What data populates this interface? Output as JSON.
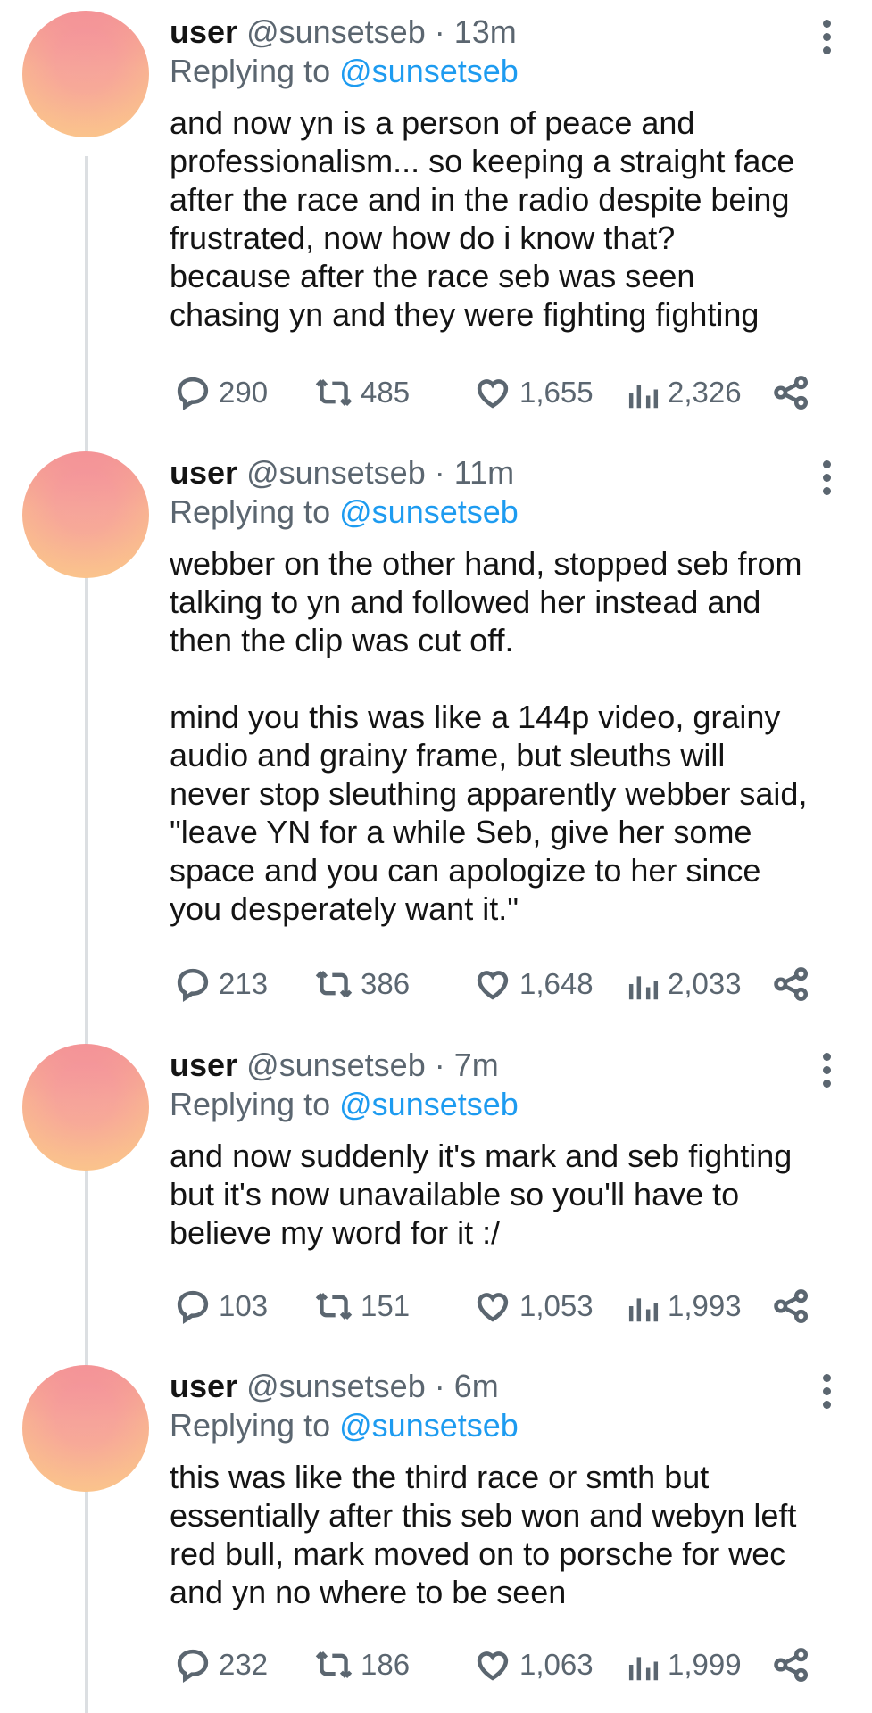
{
  "tweets": [
    {
      "user": "user",
      "handle": "@sunsetseb",
      "time": "13m",
      "replying_prefix": "Replying to",
      "replying_to": "@sunsetseb",
      "text": "and now yn is a person of peace and\nprofessionalism... so keeping a straight face\nafter the race and in the radio despite being\nfrustrated, now how do i know that?\nbecause after the race seb was seen\nchasing yn and they were fighting fighting",
      "replies": "290",
      "retweets": "485",
      "likes": "1,655",
      "views": "2,326"
    },
    {
      "user": "user",
      "handle": "@sunsetseb",
      "time": "11m",
      "replying_prefix": "Replying to",
      "replying_to": "@sunsetseb",
      "text": "webber on the other hand, stopped seb from\ntalking to yn and followed her instead and\nthen the clip was cut off.\n\nmind you this was like a 144p video, grainy\naudio and grainy frame, but sleuths will\nnever stop sleuthing apparently webber said,\n\"leave YN for a while Seb, give her some\nspace and you can apologize to her since\nyou desperately want it.\"",
      "replies": "213",
      "retweets": "386",
      "likes": "1,648",
      "views": "2,033"
    },
    {
      "user": "user",
      "handle": "@sunsetseb",
      "time": "7m",
      "replying_prefix": "Replying to",
      "replying_to": "@sunsetseb",
      "text": "and now suddenly it's mark and seb fighting\nbut it's now unavailable so you'll have to\nbelieve my word for it :/",
      "replies": "103",
      "retweets": "151",
      "likes": "1,053",
      "views": "1,993"
    },
    {
      "user": "user",
      "handle": "@sunsetseb",
      "time": "6m",
      "replying_prefix": "Replying to",
      "replying_to": "@sunsetseb",
      "text": "this was like the third race or smth but\nessentially after this seb won and webyn left\nred bull, mark moved on to porsche for wec\nand yn no where to be seen",
      "replies": "232",
      "retweets": "186",
      "likes": "1,063",
      "views": "1,999"
    }
  ],
  "icons": {
    "reply": "reply-icon",
    "retweet": "retweet-icon",
    "like": "heart-icon",
    "views": "views-icon",
    "share": "share-icon",
    "more": "more-options-icon"
  }
}
